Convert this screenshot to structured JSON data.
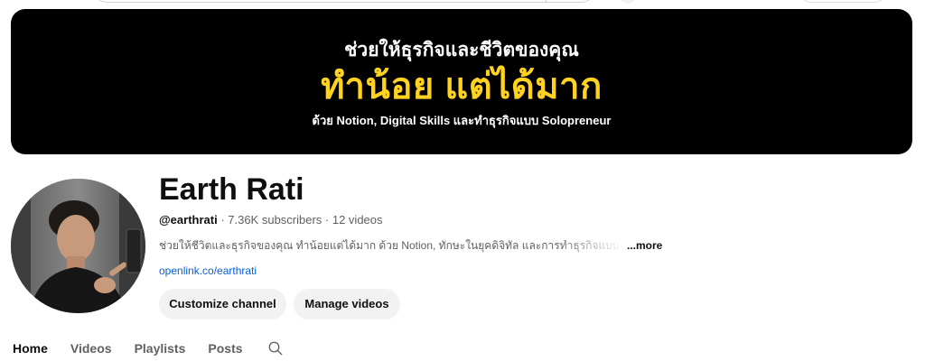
{
  "banner": {
    "line1": "ช่วยให้ธุรกิจและชีวิตของคุณ",
    "line2": "ทำน้อย แต่ได้มาก",
    "line3": "ด้วย Notion, Digital Skills และทำธุรกิจแบบ Solopreneur",
    "accent_color": "#ffd21f",
    "background_color": "#000000"
  },
  "channel": {
    "name": "Earth Rati",
    "handle": "@earthrati",
    "stats": " · 7.36K subscribers · 12 videos",
    "description": "ช่วยให้ชีวิตและธุรกิจของคุณ ทำน้อยแต่ได้มาก ด้วย Notion, ทักษะในยุคดิจิทัล และการทำธุรกิจแบบ Solopreneur",
    "more_label": "...more",
    "link": "openlink.co/earthrati",
    "link_color": "#065fd4"
  },
  "actions": {
    "customize_label": "Customize channel",
    "manage_label": "Manage videos"
  },
  "tabs": [
    {
      "label": "Home",
      "active": true
    },
    {
      "label": "Videos",
      "active": false
    },
    {
      "label": "Playlists",
      "active": false
    },
    {
      "label": "Posts",
      "active": false
    }
  ],
  "icons": {
    "tab_search": "search-icon",
    "avatar": "avatar-photo"
  }
}
